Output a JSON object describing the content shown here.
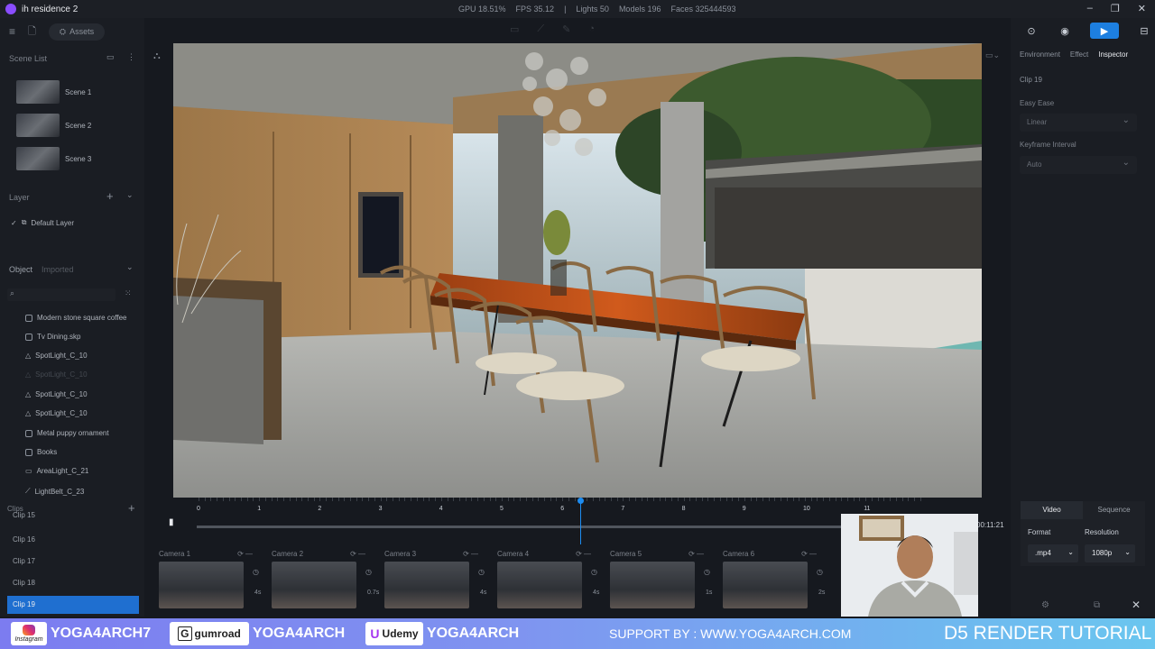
{
  "app": {
    "title": "ih residence 2"
  },
  "stats": {
    "gpu": "GPU 18.51%",
    "fps": "FPS 35.12",
    "lights": "Lights 50",
    "models": "Models 196",
    "faces": "Faces 325444593"
  },
  "toolbar": {
    "assets_label": "Assets"
  },
  "scene_list": {
    "header": "Scene List",
    "scenes": [
      {
        "label": "Scene 1"
      },
      {
        "label": "Scene 2"
      },
      {
        "label": "Scene 3"
      }
    ]
  },
  "layer": {
    "header": "Layer",
    "items": [
      {
        "label": "Default Layer"
      }
    ]
  },
  "object": {
    "header": "Object",
    "tab2": "Imported",
    "items": [
      {
        "label": "Modern stone square coffee"
      },
      {
        "label": "Tv Dining.skp"
      },
      {
        "label": "SpotLight_C_10"
      },
      {
        "label": "SpotLight_C_10"
      },
      {
        "label": "SpotLight_C_10"
      },
      {
        "label": "SpotLight_C_10"
      },
      {
        "label": "Metal puppy ornament"
      },
      {
        "label": "Books"
      },
      {
        "label": "AreaLight_C_21"
      },
      {
        "label": "LightBelt_C_23"
      }
    ]
  },
  "clips": {
    "header": "Clips",
    "items": [
      {
        "label": "Clip 15"
      },
      {
        "label": "Clip 16"
      },
      {
        "label": "Clip 17"
      },
      {
        "label": "Clip 18"
      },
      {
        "label": "Clip 19"
      }
    ]
  },
  "right_panel": {
    "tabs": [
      "Environment",
      "Effect",
      "Inspector"
    ],
    "clip_name": "Clip 19",
    "easy_ease_label": "Easy Ease",
    "easy_ease_value": "Linear",
    "keyframe_label": "Keyframe Interval",
    "keyframe_value": "Auto"
  },
  "export": {
    "tab_video": "Video",
    "tab_sequence": "Sequence",
    "format_label": "Format",
    "format_value": ".mp4",
    "resolution_label": "Resolution",
    "resolution_value": "1080p"
  },
  "timeline": {
    "ruler": [
      "0",
      "1",
      "2",
      "3",
      "4",
      "5",
      "6",
      "7",
      "8",
      "9",
      "10",
      "11"
    ],
    "time_display": "00:11:21",
    "playhead_position": 6.3,
    "cameras": [
      {
        "label": "Camera 1",
        "duration": "4s"
      },
      {
        "label": "Camera 2",
        "duration": "0.7s"
      },
      {
        "label": "Camera 3",
        "duration": "4s"
      },
      {
        "label": "Camera 4",
        "duration": "4s"
      },
      {
        "label": "Camera 5",
        "duration": "1s"
      },
      {
        "label": "Camera 6",
        "duration": "2s"
      }
    ]
  },
  "banner": {
    "instagram": "YOGA4ARCH7",
    "instagram_logo": "Instagram",
    "gumroad": "YOGA4ARCH",
    "gumroad_logo": "gumroad",
    "udemy": "YOGA4ARCH",
    "udemy_logo": "Udemy",
    "support": "SUPPORT BY : WWW.YOGA4ARCH.COM",
    "tutorial": "D5 RENDER TUTORIAL"
  },
  "colors": {
    "accent": "#1d7fe0",
    "selected_clip": "#1f6fd0",
    "logo": "#8a4dff"
  }
}
